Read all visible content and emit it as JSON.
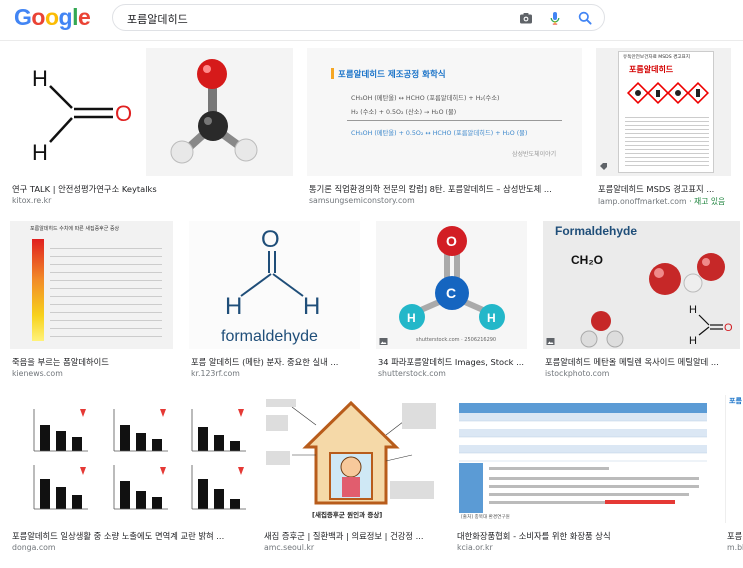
{
  "header": {
    "logo_letters": [
      {
        "ch": "G",
        "color": "#4285F4"
      },
      {
        "ch": "o",
        "color": "#EA4335"
      },
      {
        "ch": "o",
        "color": "#FBBC05"
      },
      {
        "ch": "g",
        "color": "#4285F4"
      },
      {
        "ch": "l",
        "color": "#34A853"
      },
      {
        "ch": "e",
        "color": "#EA4335"
      }
    ],
    "search_query": "포름알데히드",
    "icons": [
      "camera-icon",
      "mic-icon",
      "search-icon"
    ]
  },
  "results": [
    {
      "caption": "연구 TALK | 안전성평가연구소 Keytalks",
      "source": "kitox.re.kr",
      "source_extra": ""
    },
    {
      "caption": "통기론 직업환경의학 전문의 칼럼] 8탄. 포름알데히드 – 삼성반도체 ...",
      "source": "samsungsemiconstory.com",
      "source_extra": ""
    },
    {
      "caption": "포름알데히드 MSDS 경고표지 ...",
      "source": "lamp.onoffmarket.com",
      "source_extra": " · 재고 있음"
    },
    {
      "caption": "죽음을 부르는 폼알데하이드",
      "source": "kienews.com",
      "source_extra": ""
    },
    {
      "caption": "포름 알데히드 (메탄) 분자. 중요한 실내 ...",
      "source": "kr.123rf.com",
      "source_extra": ""
    },
    {
      "caption": "34 파라포름알데히드 Images, Stock ...",
      "source": "shutterstock.com",
      "source_extra": ""
    },
    {
      "caption": "포름알데히드 메탄올 메틸렌 옥사이드 메틸알데 ...",
      "source": "istockphoto.com",
      "source_extra": ""
    },
    {
      "caption": "포름알데히드 일상생활 중 소량 노출에도 면역계 교란 밝혀 ...",
      "source": "donga.com",
      "source_extra": ""
    },
    {
      "caption": "새집 증후군 | 질환백과 | 의료정보 | 건강정 ...",
      "source": "amc.seoul.kr",
      "source_extra": ""
    },
    {
      "caption": "대한화장품협회 - 소비자를 위한 화장품 상식",
      "source": "kcia.or.kr",
      "source_extra": ""
    },
    {
      "caption": "포름",
      "source": "m.bl",
      "source_extra": ""
    }
  ],
  "thumb_text": {
    "r1b_title": "포름알데히드 제조공정 화학식",
    "r1b_lines": [
      "CH₃OH (메탄올)  ↔  HCHO (포름알데히드) + H₂(수소)",
      "H₂ (수소) + 0.5O₂ (산소) → H₂O (물)",
      "CH₃OH (메탄올) + 0.5O₂ ↔ HCHO (포름알데히드) + H₂O (물)"
    ],
    "r1b_watermark": "삼성반도체이야기",
    "msds_title": "유독안전보건자료 MSDS 경고표지",
    "msds_name": "포름알데히드",
    "chart_title": "포름알데히드 수치에 따른 새집증후군 증상",
    "formaldehyde": "formaldehyde",
    "formaldehyde_cap": "Formaldehyde",
    "ch2o": "CH₂O",
    "shutter": "shutterstock.com · 2506216290",
    "r3b_title": "[새집증후군 원인과 증상]",
    "r3c_note": "[출처] 충북대 환경연구원"
  }
}
